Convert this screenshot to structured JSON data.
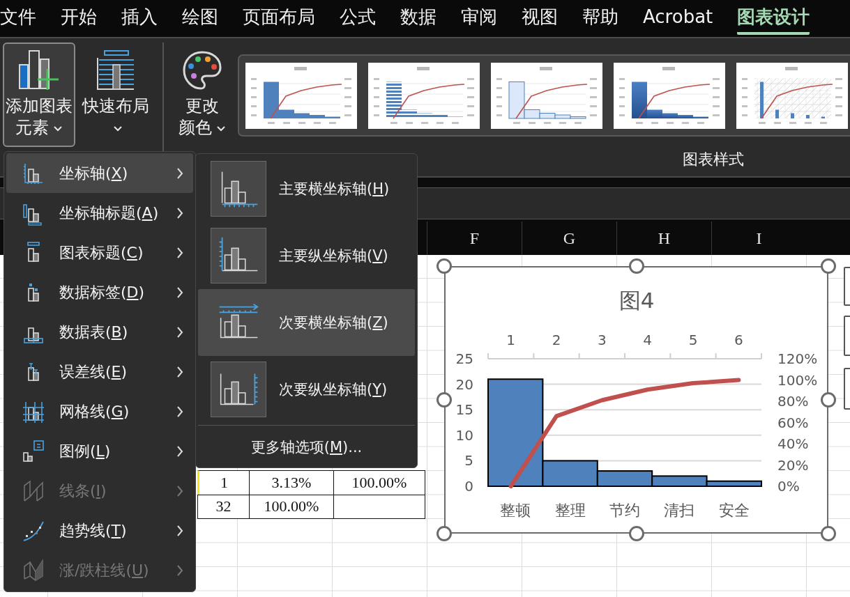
{
  "tabs": [
    {
      "label": "文件",
      "selected": false
    },
    {
      "label": "开始",
      "selected": false
    },
    {
      "label": "插入",
      "selected": false
    },
    {
      "label": "绘图",
      "selected": false
    },
    {
      "label": "页面布局",
      "selected": false
    },
    {
      "label": "公式",
      "selected": false
    },
    {
      "label": "数据",
      "selected": false
    },
    {
      "label": "审阅",
      "selected": false
    },
    {
      "label": "视图",
      "selected": false
    },
    {
      "label": "帮助",
      "selected": false
    },
    {
      "label": "Acrobat",
      "selected": false
    },
    {
      "label": "图表设计",
      "selected": true
    }
  ],
  "ribbon": {
    "buttons": [
      {
        "label": "添加图表元素",
        "open": true
      },
      {
        "label": "快速布局",
        "open": false
      },
      {
        "label": "更改颜色",
        "open": false
      }
    ],
    "chart_styles": [
      {
        "kind": "solid"
      },
      {
        "kind": "striped"
      },
      {
        "kind": "outline"
      },
      {
        "kind": "gradient"
      },
      {
        "kind": "pattern"
      }
    ],
    "group_label": "图表样式"
  },
  "add_element_menu": {
    "items": [
      {
        "label_before": "坐标轴(",
        "access_key": "X",
        "label_after": ")",
        "selected": true,
        "disabled": false
      },
      {
        "label_before": "坐标轴标题(",
        "access_key": "A",
        "label_after": ")",
        "selected": false,
        "disabled": false
      },
      {
        "label_before": "图表标题(",
        "access_key": "C",
        "label_after": ")",
        "selected": false,
        "disabled": false
      },
      {
        "label_before": "数据标签(",
        "access_key": "D",
        "label_after": ")",
        "selected": false,
        "disabled": false
      },
      {
        "label_before": "数据表(",
        "access_key": "B",
        "label_after": ")",
        "selected": false,
        "disabled": false
      },
      {
        "label_before": "误差线(",
        "access_key": "E",
        "label_after": ")",
        "selected": false,
        "disabled": false
      },
      {
        "label_before": "网格线(",
        "access_key": "G",
        "label_after": ")",
        "selected": false,
        "disabled": false
      },
      {
        "label_before": "图例(",
        "access_key": "L",
        "label_after": ")",
        "selected": false,
        "disabled": false
      },
      {
        "label_before": "线条(",
        "access_key": "I",
        "label_after": ")",
        "selected": false,
        "disabled": true
      },
      {
        "label_before": "趋势线(",
        "access_key": "T",
        "label_after": ")",
        "selected": false,
        "disabled": false
      },
      {
        "label_before": "涨/跌柱线(",
        "access_key": "U",
        "label_after": ")",
        "selected": false,
        "disabled": true
      }
    ]
  },
  "axes_submenu": {
    "items": [
      {
        "label_before": "主要横坐标轴(",
        "access_key": "H",
        "label_after": ")",
        "selected": false
      },
      {
        "label_before": "主要纵坐标轴(",
        "access_key": "V",
        "label_after": ")",
        "selected": false
      },
      {
        "label_before": "次要横坐标轴(",
        "access_key": "Z",
        "label_after": ")",
        "selected": true
      },
      {
        "label_before": "次要纵坐标轴(",
        "access_key": "Y",
        "label_after": ")",
        "selected": false
      }
    ],
    "footer": {
      "label_before": "更多轴选项(",
      "access_key": "M",
      "label_after": ")..."
    }
  },
  "sheet": {
    "columns": [
      "F",
      "G",
      "H",
      "I"
    ],
    "rows": [
      {
        "cells": [
          "1",
          "3.13%",
          "100.00%"
        ]
      },
      {
        "cells": [
          "32",
          "100.00%"
        ]
      }
    ]
  },
  "chart": {
    "chart_data": {
      "type": "bar",
      "title": "图4",
      "categories": [
        "整顿",
        "整理",
        "节约",
        "清扫",
        "安全"
      ],
      "series": [
        {
          "color": "#4f81bd",
          "values": [
            21,
            5,
            3,
            2,
            1
          ]
        }
      ],
      "ylim": [
        0,
        25
      ],
      "yticks": [
        0,
        5,
        10,
        15,
        20,
        25
      ],
      "grid": true
    },
    "overlay": {
      "chart_data": {
        "type": "line",
        "x": [
          1,
          2,
          3,
          4,
          5,
          6
        ],
        "xlim": [
          0.5,
          6.5
        ],
        "xticks": [
          1,
          2,
          3,
          4,
          5,
          6
        ],
        "series": [
          {
            "color": "#c0504d",
            "values": [
              0,
              66,
              81,
              91,
              97,
              100
            ]
          }
        ],
        "ylim": [
          0,
          120
        ],
        "yticks": [
          {
            "value": 0,
            "label": "0%"
          },
          {
            "value": 20,
            "label": "20%"
          },
          {
            "value": 40,
            "label": "40%"
          },
          {
            "value": 60,
            "label": "60%"
          },
          {
            "value": 80,
            "label": "80%"
          },
          {
            "value": 100,
            "label": "100%"
          },
          {
            "value": 120,
            "label": "120%"
          }
        ]
      }
    }
  }
}
